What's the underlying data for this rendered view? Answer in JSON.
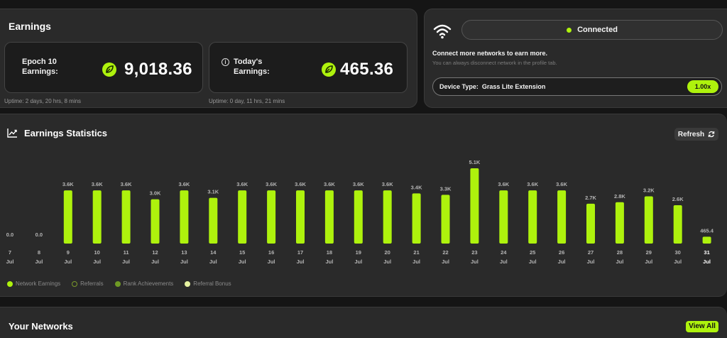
{
  "earnings": {
    "title": "Earnings",
    "epoch": {
      "label_line1": "Epoch 10",
      "label_line2": "Earnings:",
      "value": "9,018.36",
      "uptime": "Uptime: 2 days, 20 hrs, 8 mins"
    },
    "today": {
      "label_line1": "Today's",
      "label_line2": "Earnings:",
      "value": "465.36",
      "uptime": "Uptime: 0 day, 11 hrs, 21 mins"
    },
    "info_glyph": "i"
  },
  "network": {
    "status": "Connected",
    "connect_more": "Connect more networks to earn more.",
    "disconnect_note": "You can always disconnect network in the profile tab.",
    "device_label": "Device Type:",
    "device_name": "Grass Lite Extension",
    "multiplier": "1.00x"
  },
  "statistics": {
    "title": "Earnings Statistics",
    "refresh_label": "Refresh",
    "legend": [
      {
        "label": "Network Earnings",
        "color": "#aef20d"
      },
      {
        "label": "Referrals",
        "color": "#4a5a1e"
      },
      {
        "label": "Rank Achievements",
        "color": "#6f9a24"
      },
      {
        "label": "Referral Bonus",
        "color": "#e6f2a0"
      }
    ]
  },
  "chart_data": {
    "type": "bar",
    "categories": [
      "7",
      "8",
      "9",
      "10",
      "11",
      "12",
      "13",
      "14",
      "15",
      "16",
      "17",
      "18",
      "19",
      "20",
      "21",
      "22",
      "23",
      "24",
      "25",
      "26",
      "27",
      "28",
      "29",
      "30",
      "31"
    ],
    "category_sublabel": "Jul",
    "values": [
      0,
      0,
      3600,
      3600,
      3600,
      3000,
      3600,
      3100,
      3600,
      3600,
      3600,
      3600,
      3600,
      3600,
      3400,
      3300,
      5100,
      3600,
      3600,
      3600,
      2700,
      2800,
      3200,
      2600,
      465.4
    ],
    "data_labels": [
      "0.0",
      "0.0",
      "3.6K",
      "3.6K",
      "3.6K",
      "3.0K",
      "3.6K",
      "3.1K",
      "3.6K",
      "3.6K",
      "3.6K",
      "3.6K",
      "3.6K",
      "3.6K",
      "3.4K",
      "3.3K",
      "5.1K",
      "3.6K",
      "3.6K",
      "3.6K",
      "2.7K",
      "2.8K",
      "3.2K",
      "2.6K",
      "465.4"
    ],
    "bar_color": "#aef20d",
    "highlight_index": 24,
    "ylim": [
      0,
      5100
    ],
    "grid": false,
    "legend_position": "bottom-left"
  },
  "networks": {
    "title": "Your Networks",
    "view_all_label": "View All"
  }
}
